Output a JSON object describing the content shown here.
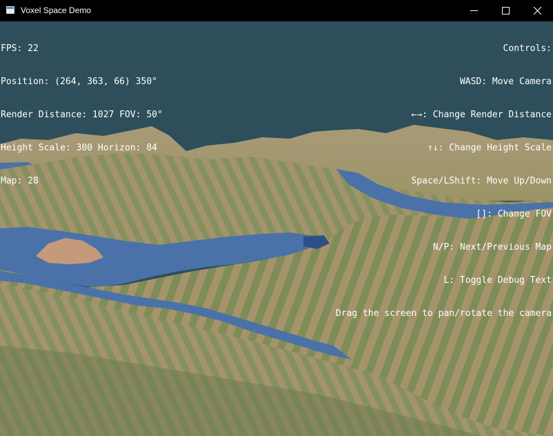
{
  "window": {
    "title": "Voxel Space Demo",
    "icons": {
      "app": "app-window-icon",
      "minimize": "minimize-icon",
      "maximize": "maximize-icon",
      "close": "close-icon"
    }
  },
  "debug": {
    "fps": "FPS: 22",
    "position": "Position: (264, 363, 66) 350°",
    "render": "Render Distance: 1027 FOV: 50°",
    "height": "Height Scale: 300 Horizon: 84",
    "map": "Map: 28"
  },
  "controls": {
    "header": "Controls:",
    "items": [
      "WASD: Move Camera",
      "←→: Change Render Distance",
      "↑↓: Change Height Scale",
      "Space/LShift: Move Up/Down",
      "[]: Change FOV",
      "N/P: Next/Previous Map",
      "L: Toggle Debug Text",
      "Drag the screen to pan/rotate the camera"
    ]
  },
  "colors": {
    "sky": "#2d4e5a",
    "water": "#4a72a8",
    "water_dark": "#2c4f86",
    "grass": "#7c8a5a",
    "sand": "#c49a7a",
    "hud_text": "#ffffff"
  }
}
